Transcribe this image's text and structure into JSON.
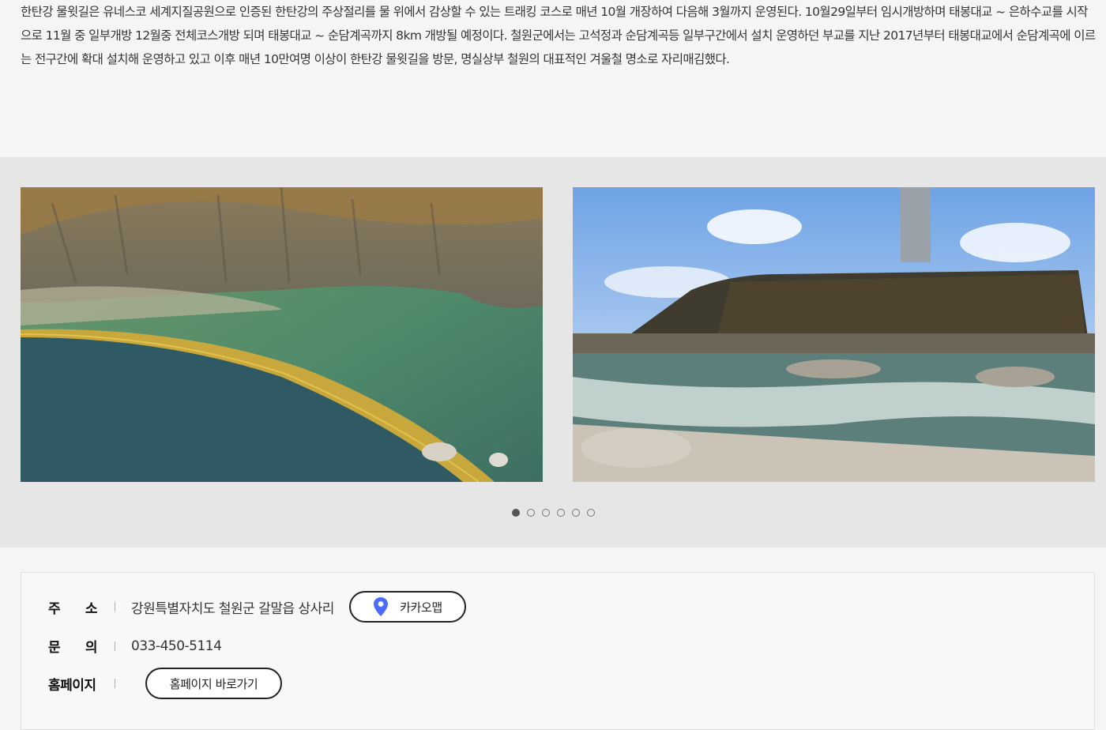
{
  "description": "한탄강 물윗길은 유네스코 세계지질공원으로 인증된 한탄강의 주상절리를 물 위에서 감상할 수 있는 트래킹 코스로 매년 10월 개장하여 다음해 3월까지 운영된다. 10월29일부터 임시개방하며 태봉대교 ~ 은하수교를 시작으로 11월 중 일부개방 12월중 전체코스개방 되며 태봉대교 ~ 순담계곡까지 8km 개방될 예정이다. 철원군에서는 고석정과 순담계곡등 일부구간에서 설치 운영하던 부교를 지난 2017년부터 태봉대교에서 순담계곡에 이르는 전구간에 확대 설치해 운영하고 있고 이후 매년 10만여명 이상이 한탄강 물윗길을 방문, 명실상부 철원의 대표적인 겨울철 명소로 자리매김했다.",
  "gallery": {
    "dot_count": 6,
    "active_index": 0
  },
  "info": {
    "address_label": "주 소",
    "address_value": "강원특별자치도 철원군 갈말읍 상사리",
    "map_button": "카카오맵",
    "phone_label": "문 의",
    "phone_value": "033-450-5114",
    "homepage_label": "홈페이지",
    "homepage_button": "홈페이지 바로가기"
  },
  "colors": {
    "pin": "#4a6cf7",
    "gallery_bg": "#e6e6e6",
    "page_bg": "#f5f5f5"
  },
  "icons": {
    "map_pin": "map-pin-icon"
  }
}
